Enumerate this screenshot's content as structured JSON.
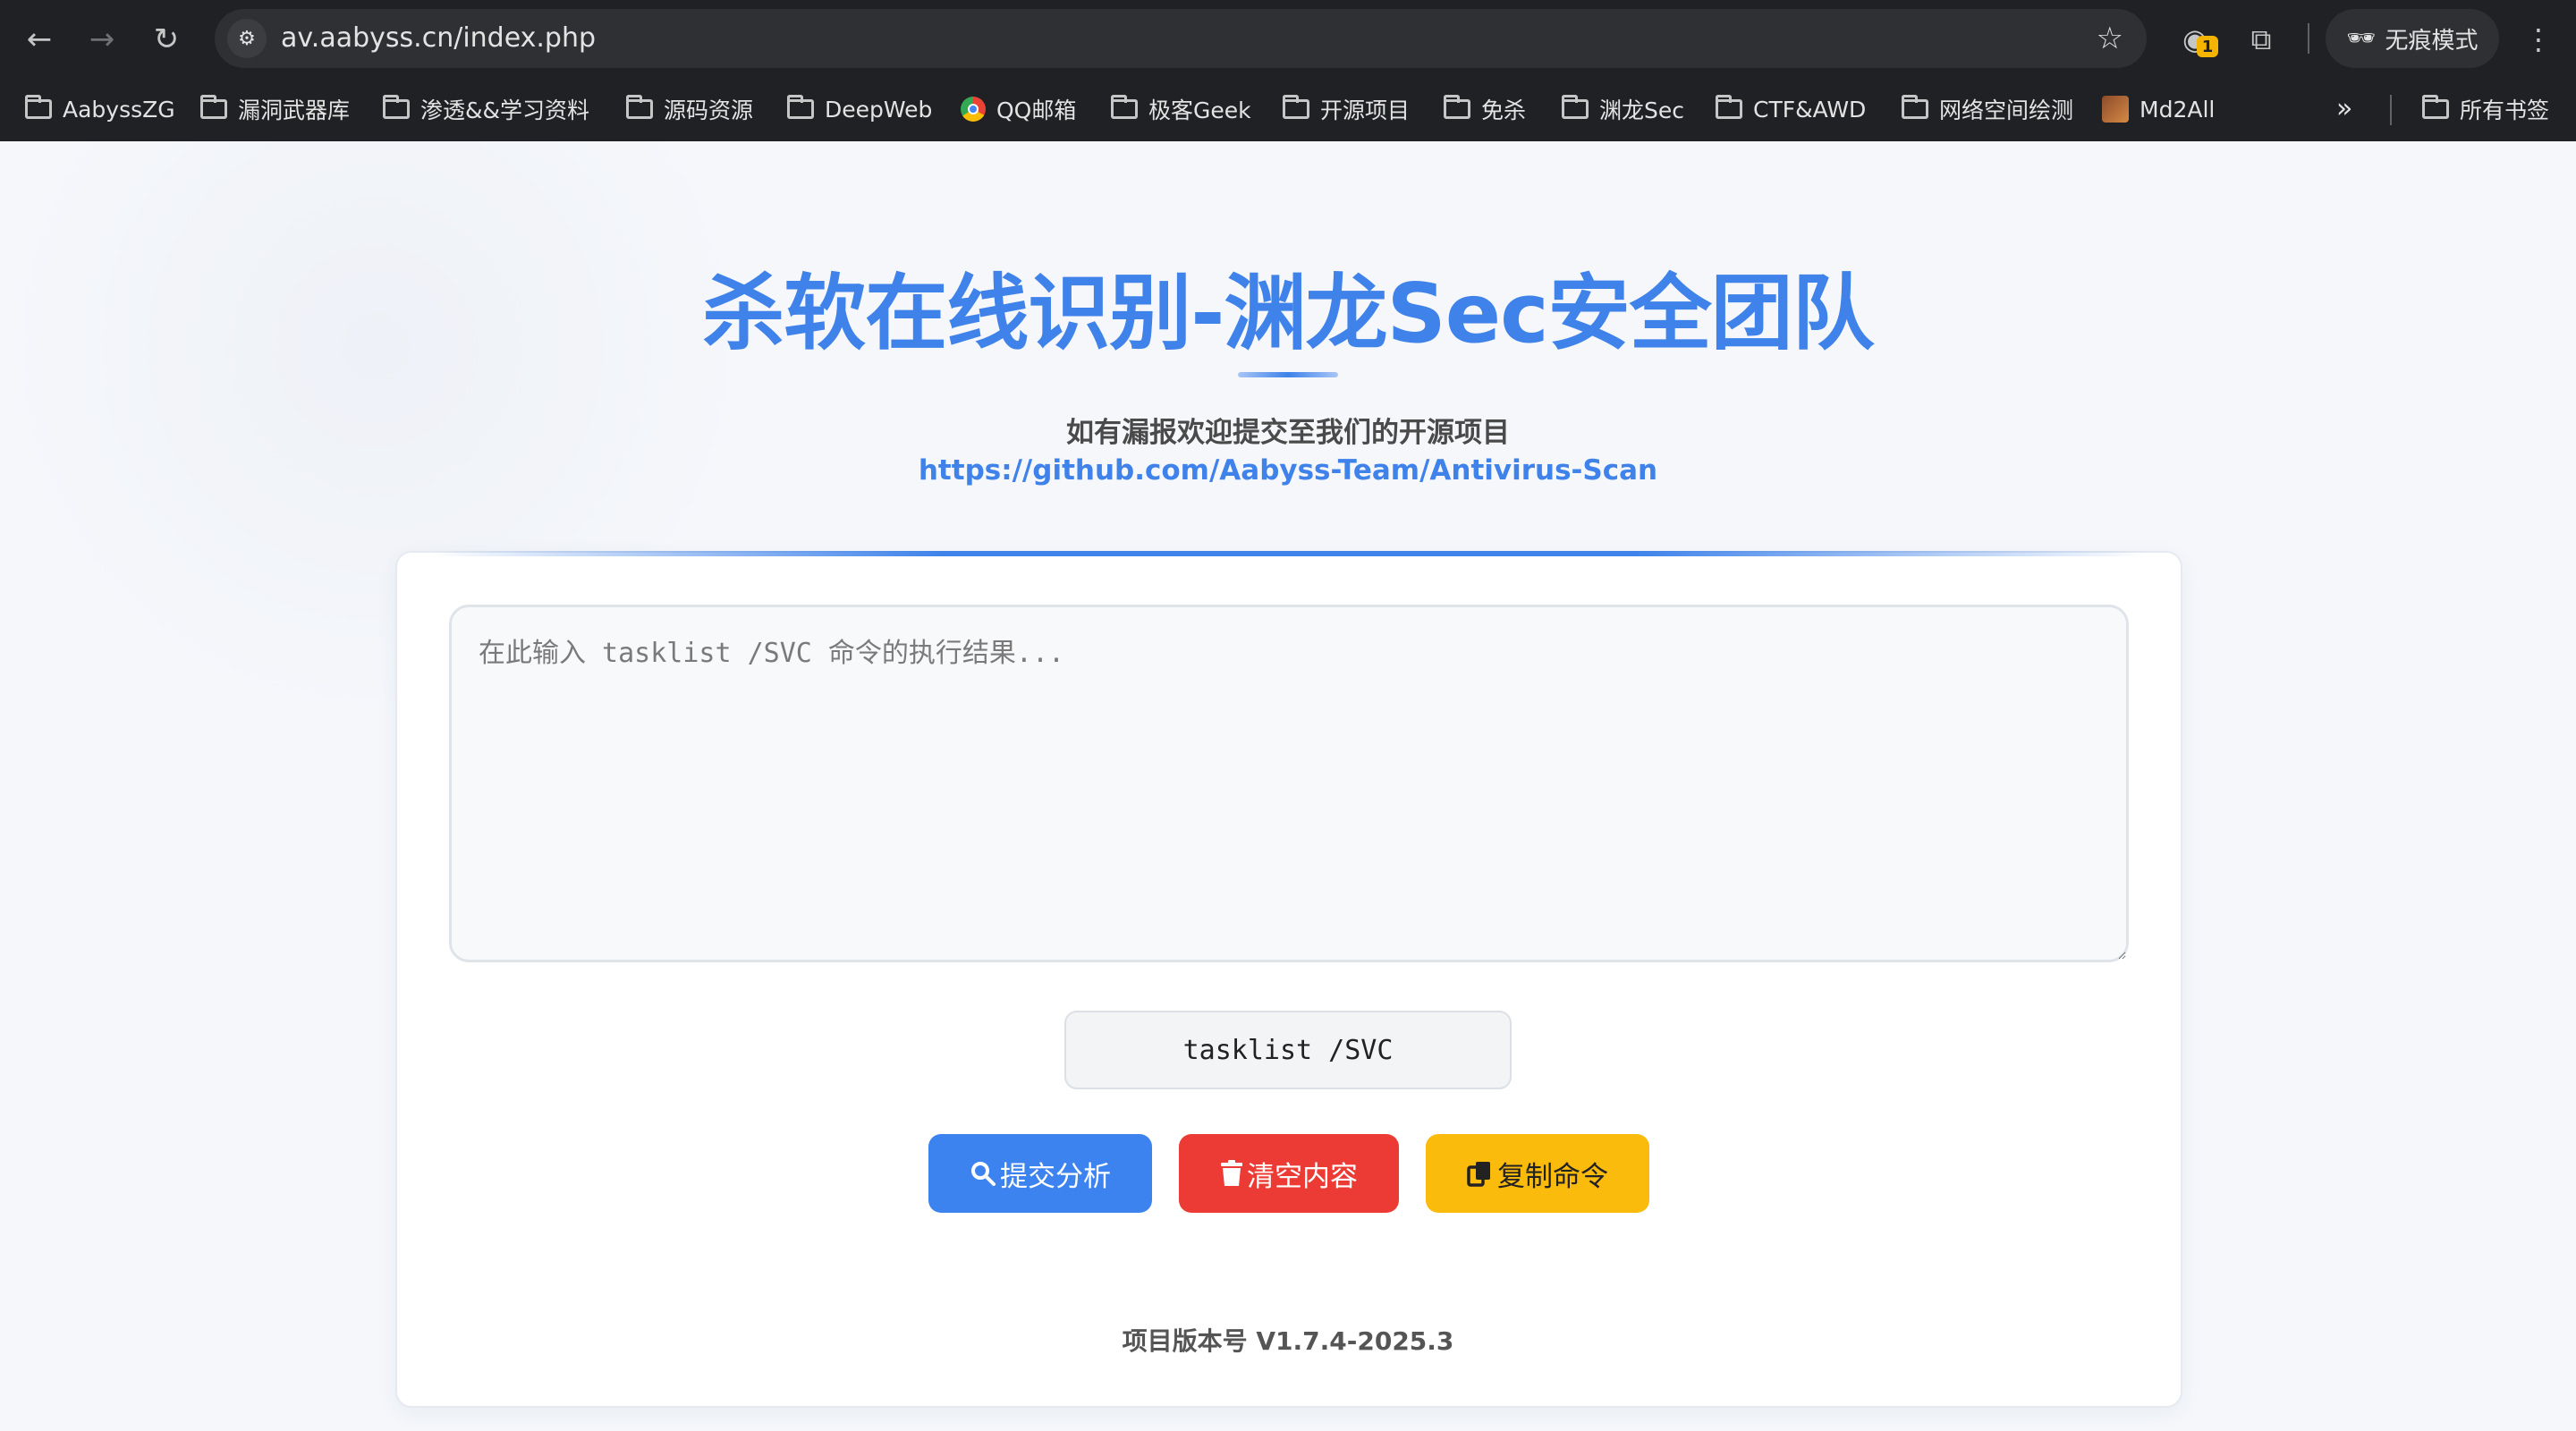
{
  "browser": {
    "url": "av.aabyss.cn/index.php",
    "incognito_label": "无痕模式",
    "extension_badge": "1",
    "bookmarks": [
      {
        "label": "AabyssZG",
        "icon": "folder-icon"
      },
      {
        "label": "漏洞武器库",
        "icon": "folder-icon"
      },
      {
        "label": "渗透&&学习资料",
        "icon": "folder-icon"
      },
      {
        "label": "源码资源",
        "icon": "folder-icon"
      },
      {
        "label": "DeepWeb",
        "icon": "folder-icon"
      },
      {
        "label": "QQ邮箱",
        "icon": "qq-mail-icon"
      },
      {
        "label": "极客Geek",
        "icon": "folder-icon"
      },
      {
        "label": "开源项目",
        "icon": "folder-icon"
      },
      {
        "label": "免杀",
        "icon": "folder-icon"
      },
      {
        "label": "渊龙Sec",
        "icon": "folder-icon"
      },
      {
        "label": "CTF&AWD",
        "icon": "folder-icon"
      },
      {
        "label": "网络空间绘测",
        "icon": "folder-icon"
      },
      {
        "label": "Md2All",
        "icon": "md2all-icon"
      }
    ],
    "all_bookmarks_label": "所有书签"
  },
  "page": {
    "title": "杀软在线识别-渊龙Sec安全团队",
    "subtitle": "如有漏报欢迎提交至我们的开源项目",
    "repo_link": "https://github.com/Aabyss-Team/Antivirus-Scan",
    "input_placeholder": "在此输入 tasklist /SVC 命令的执行结果...",
    "command": "tasklist /SVC",
    "buttons": {
      "submit": "提交分析",
      "clear": "清空内容",
      "copy": "复制命令"
    },
    "version": "项目版本号 V1.7.4-2025.3"
  },
  "colors": {
    "accent": "#3e82ea",
    "submit": "#3d83f0",
    "clear": "#ec3b35",
    "copy": "#fbbb0c"
  }
}
